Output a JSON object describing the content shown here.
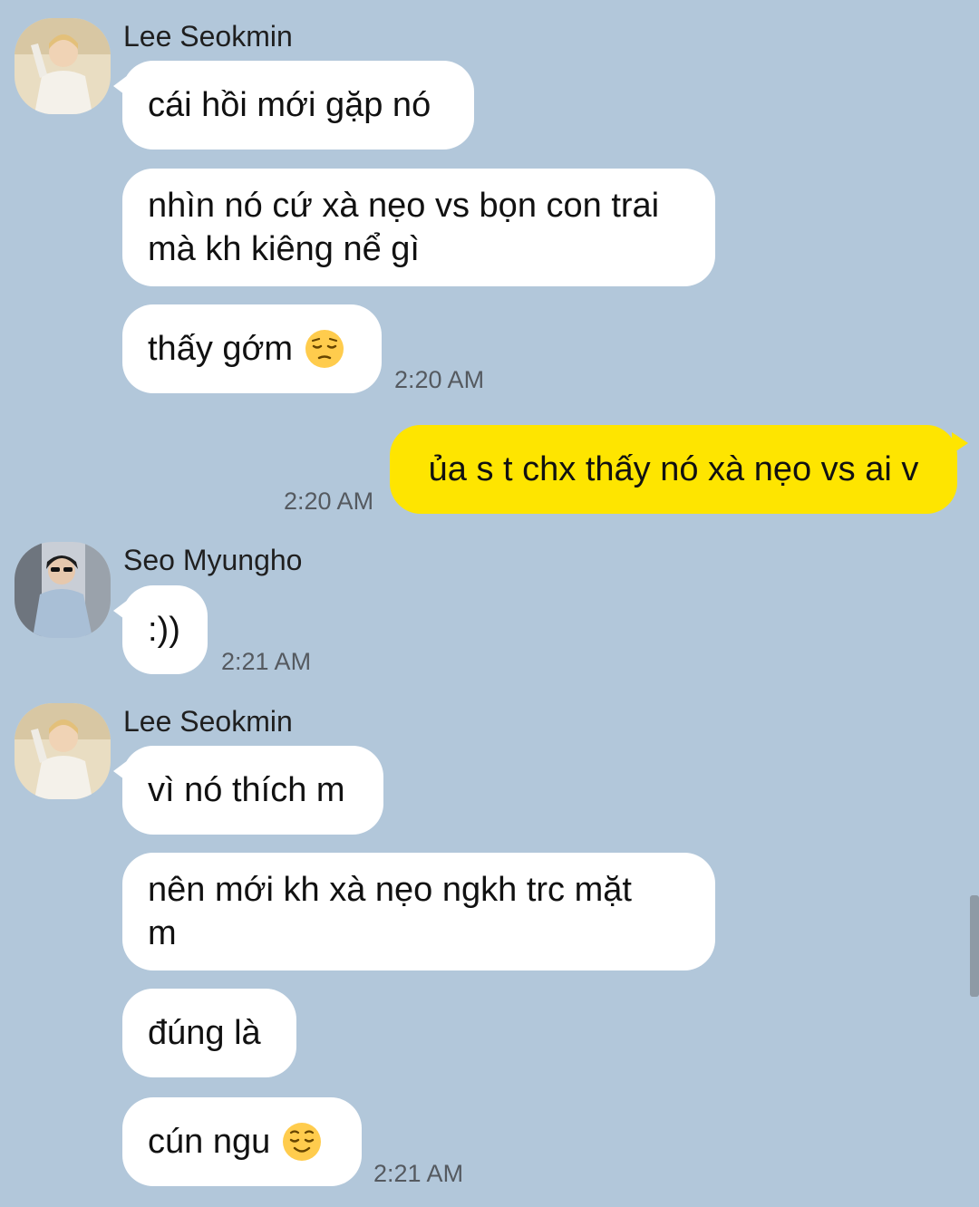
{
  "messages": [
    {
      "sender": "Lee Seokmin"
    },
    {
      "text": "cái hồi mới gặp nó"
    },
    {
      "text": "nhìn nó cứ xà nẹo vs bọn con trai\nmà kh kiêng nể gì"
    },
    {
      "text": "thấy gớm",
      "emoji": "pensive-face-icon",
      "time": "2:20 AM"
    },
    {
      "text": "ủa s t chx thấy nó xà nẹo vs ai v",
      "time": "2:20 AM"
    },
    {
      "sender": "Seo Myungho"
    },
    {
      "text": ":))",
      "time": "2:21 AM"
    },
    {
      "sender": "Lee Seokmin"
    },
    {
      "text": "vì nó thích m"
    },
    {
      "text": "nên mới kh xà nẹo ngkh trc mặt\nm"
    },
    {
      "text": "đúng là"
    },
    {
      "text": "cún ngu",
      "emoji": "relieved-face-icon",
      "time": "2:21 AM"
    }
  ],
  "colors": {
    "background": "#b2c7da",
    "incoming_bubble": "#ffffff",
    "outgoing_bubble": "#fee500",
    "timestamp": "#555a60"
  }
}
